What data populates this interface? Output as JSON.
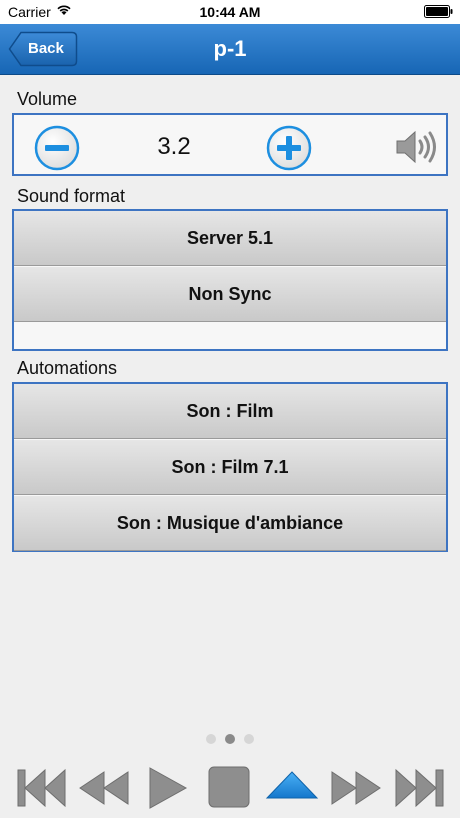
{
  "status_bar": {
    "carrier": "Carrier",
    "time": "10:44 AM"
  },
  "nav": {
    "back_label": "Back",
    "title": "p-1"
  },
  "volume": {
    "label": "Volume",
    "value": "3.2"
  },
  "sound_format": {
    "label": "Sound format",
    "options": [
      "Server 5.1",
      "Non Sync"
    ]
  },
  "automations": {
    "label": "Automations",
    "items": [
      "Son : Film",
      "Son : Film 7.1",
      "Son : Musique d'ambiance"
    ]
  },
  "pager": {
    "pages": 3,
    "current": 2
  },
  "colors": {
    "nav_blue": "#1f6fc2",
    "accent_blue": "#1d8fe0",
    "panel_border": "#3d74c2",
    "transport_gray": "#8e8e8e"
  }
}
